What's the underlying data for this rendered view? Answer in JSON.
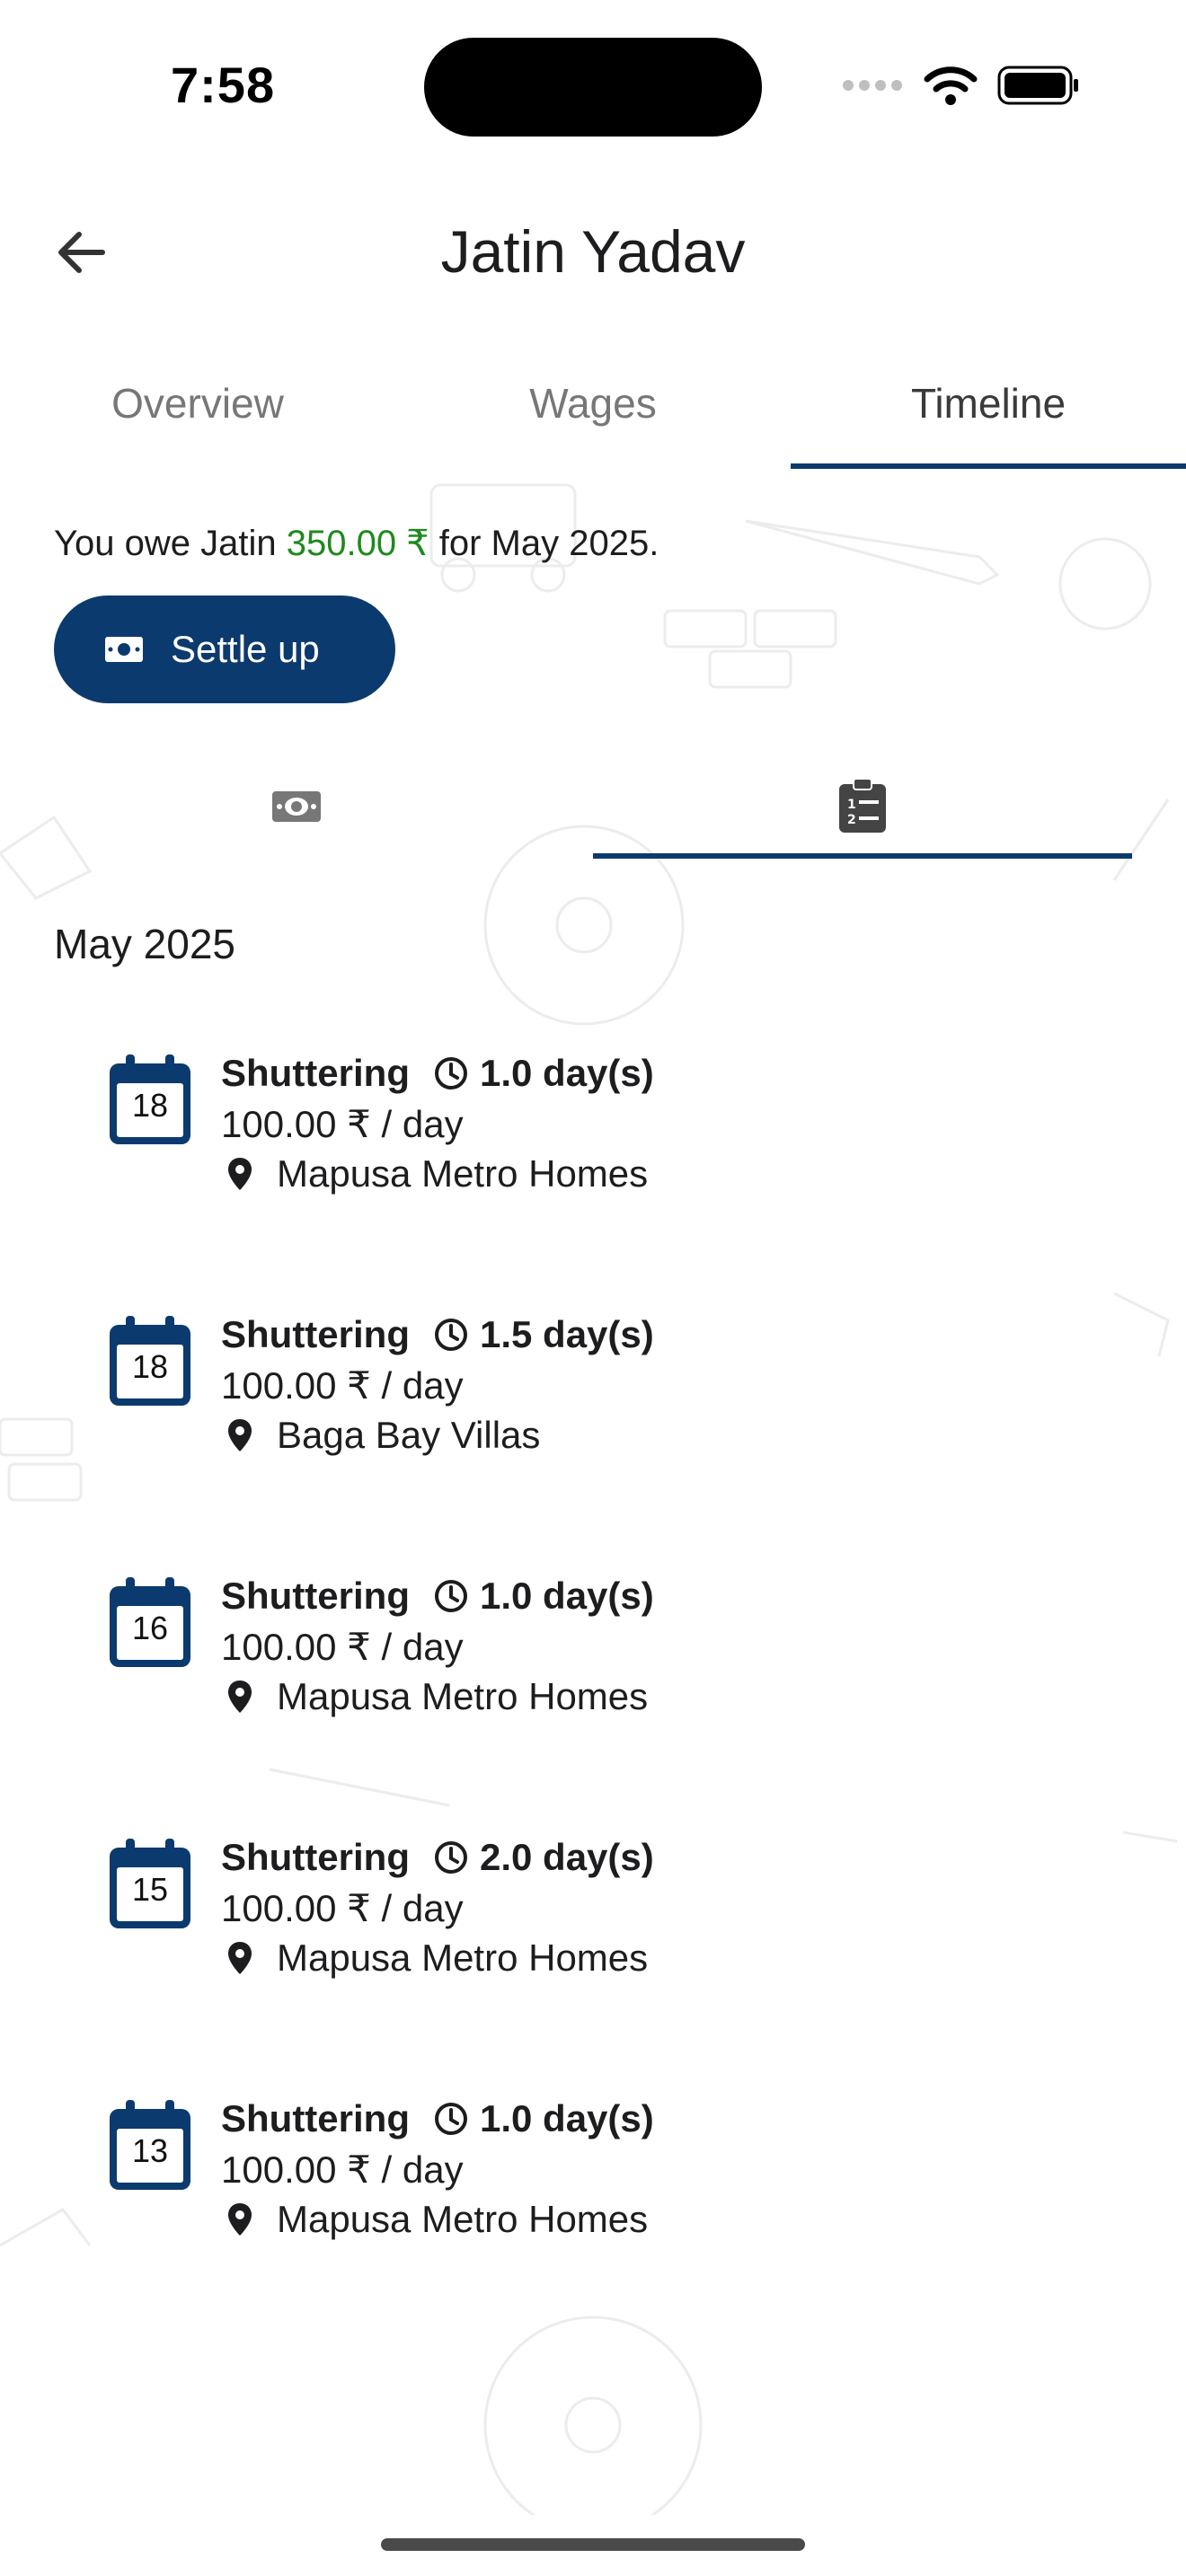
{
  "status_bar": {
    "time": "7:58"
  },
  "header": {
    "title": "Jatin Yadav"
  },
  "tabs": [
    {
      "label": "Overview",
      "active": false
    },
    {
      "label": "Wages",
      "active": false
    },
    {
      "label": "Timeline",
      "active": true
    }
  ],
  "summary": {
    "prefix": "You owe Jatin ",
    "amount": "350.00 ₹",
    "suffix": " for May 2025."
  },
  "settle_button": {
    "label": "Settle up",
    "icon": "cash-icon"
  },
  "subtabs": [
    {
      "icon": "cash-icon",
      "active": false
    },
    {
      "icon": "clipboard-list-icon",
      "active": true
    }
  ],
  "section": {
    "title": "May 2025"
  },
  "entries": [
    {
      "day": "18",
      "work": "Shuttering",
      "duration": "1.0 day(s)",
      "rate": "100.00 ₹ / day",
      "site": "Mapusa Metro Homes"
    },
    {
      "day": "18",
      "work": "Shuttering",
      "duration": "1.5 day(s)",
      "rate": "100.00 ₹ / day",
      "site": "Baga Bay Villas"
    },
    {
      "day": "16",
      "work": "Shuttering",
      "duration": "1.0 day(s)",
      "rate": "100.00 ₹ / day",
      "site": "Mapusa Metro Homes"
    },
    {
      "day": "15",
      "work": "Shuttering",
      "duration": "2.0 day(s)",
      "rate": "100.00 ₹ / day",
      "site": "Mapusa Metro Homes"
    },
    {
      "day": "13",
      "work": "Shuttering",
      "duration": "1.0 day(s)",
      "rate": "100.00 ₹ / day",
      "site": "Mapusa Metro Homes"
    }
  ],
  "colors": {
    "primary": "#0b3a6e",
    "amount_green": "#1d8a1d",
    "tab_inactive": "#777777"
  }
}
